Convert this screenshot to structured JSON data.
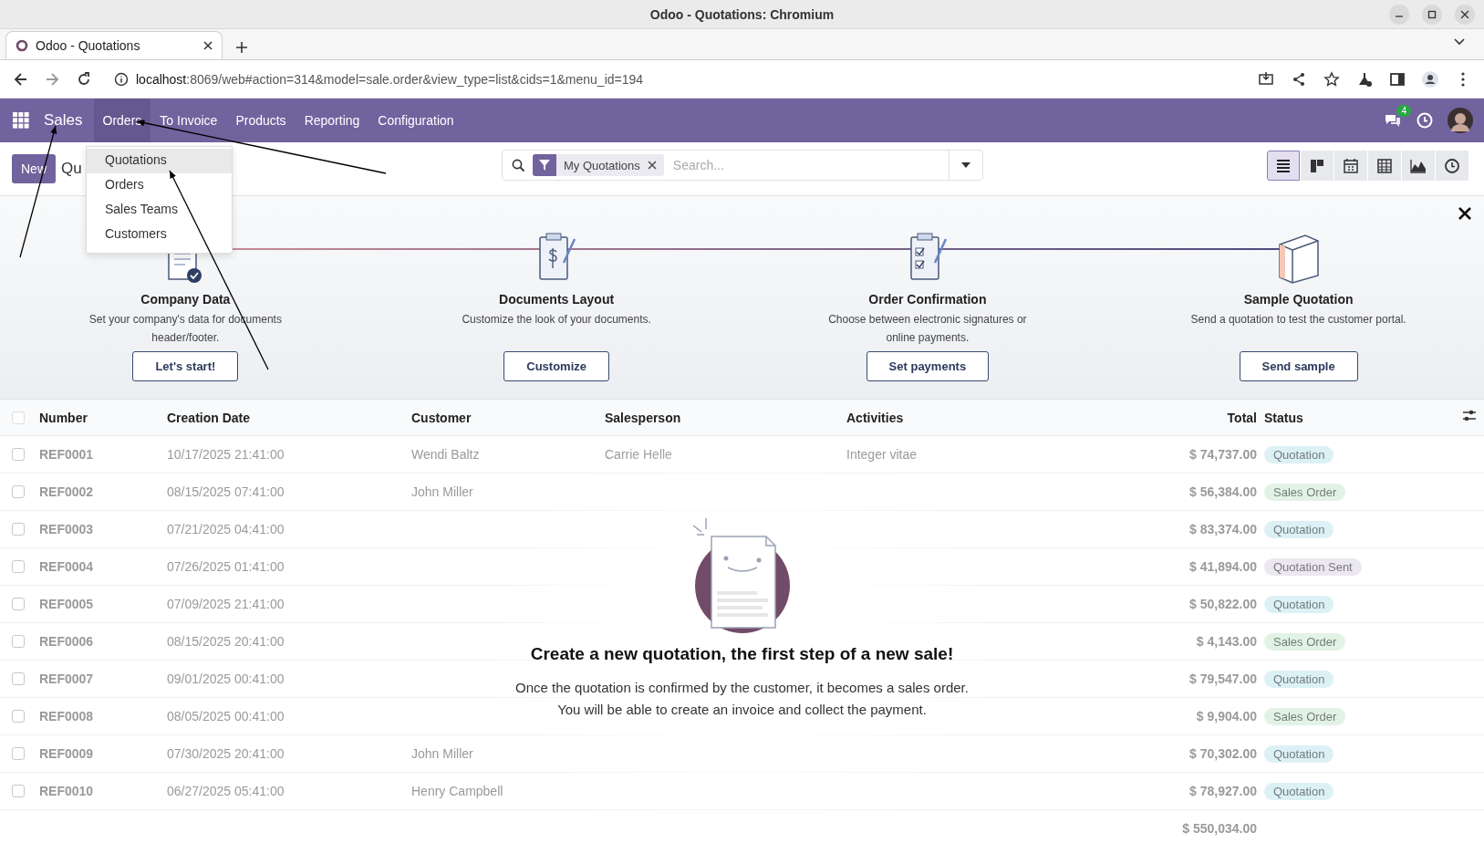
{
  "window": {
    "title": "Odoo - Quotations: Chromium"
  },
  "browser": {
    "tabs": [
      {
        "label": "Odoo - Quotations",
        "selected": true
      }
    ],
    "url_host": "localhost",
    "url_path": ":8069/web#action=314&model=sale.order&view_type=list&cids=1&menu_id=194"
  },
  "navbar": {
    "app": "Sales",
    "menu": [
      {
        "label": "Orders",
        "selected": true
      },
      {
        "label": "To Invoice",
        "selected": false
      },
      {
        "label": "Products",
        "selected": false
      },
      {
        "label": "Reporting",
        "selected": false
      },
      {
        "label": "Configuration",
        "selected": false
      }
    ],
    "messages_badge": "4"
  },
  "dropdown": {
    "items": [
      {
        "label": "Quotations",
        "selected": true
      },
      {
        "label": "Orders",
        "selected": false
      },
      {
        "label": "Sales Teams",
        "selected": false
      },
      {
        "label": "Customers",
        "selected": false
      }
    ]
  },
  "control_panel": {
    "new_button": "New",
    "breadcrumb": "Qu",
    "facet": "My Quotations",
    "search_placeholder": "Search...",
    "views": [
      {
        "kind": "list",
        "selected": true
      },
      {
        "kind": "kanban",
        "selected": false
      },
      {
        "kind": "calendar",
        "selected": false
      },
      {
        "kind": "pivot",
        "selected": false
      },
      {
        "kind": "graph",
        "selected": false
      },
      {
        "kind": "activity",
        "selected": false
      }
    ]
  },
  "onboarding": {
    "steps": [
      {
        "kind": "company",
        "title": "Company Data",
        "description": "Set your company's data for documents header/footer.",
        "button": "Let's start!"
      },
      {
        "kind": "layout",
        "title": "Documents Layout",
        "description": "Customize the look of your documents.",
        "button": "Customize"
      },
      {
        "kind": "confirmation",
        "title": "Order Confirmation",
        "description": "Choose between electronic signatures or online payments.",
        "button": "Set payments"
      },
      {
        "kind": "sample",
        "title": "Sample Quotation",
        "description": "Send a quotation to test the customer portal.",
        "button": "Send sample"
      }
    ]
  },
  "table": {
    "select_all_checked": false,
    "columns": [
      "Number",
      "Creation Date",
      "Customer",
      "Salesperson",
      "Activities",
      "Total",
      "Status"
    ],
    "rows": [
      {
        "checked": false,
        "number": "REF0001",
        "date": "10/17/2025 21:41:00",
        "customer": "Wendi Baltz",
        "salesperson": "Carrie Helle",
        "activity": "Integer vitae",
        "total": "$ 74,737.00",
        "status": "Quotation",
        "color": "#dcf1f5"
      },
      {
        "checked": false,
        "number": "REF0002",
        "date": "08/15/2025 07:41:00",
        "customer": "John Miller",
        "total": "$ 56,384.00",
        "status": "Sales Order",
        "color": "#e2f3e5"
      },
      {
        "checked": false,
        "number": "REF0003",
        "date": "07/21/2025 04:41:00",
        "total": "$ 83,374.00",
        "status": "Quotation",
        "color": "#dcf1f5"
      },
      {
        "checked": false,
        "number": "REF0004",
        "date": "07/26/2025 01:41:00",
        "total": "$ 41,894.00",
        "status": "Quotation Sent",
        "color": "#ebe8f0"
      },
      {
        "checked": false,
        "number": "REF0005",
        "date": "07/09/2025 21:41:00",
        "total": "$ 50,822.00",
        "status": "Quotation",
        "color": "#dcf1f5"
      },
      {
        "checked": false,
        "number": "REF0006",
        "date": "08/15/2025 20:41:00",
        "total": "$ 4,143.00",
        "status": "Sales Order",
        "color": "#e2f3e5"
      },
      {
        "checked": false,
        "number": "REF0007",
        "date": "09/01/2025 00:41:00",
        "total": "$ 79,547.00",
        "status": "Quotation",
        "color": "#dcf1f5"
      },
      {
        "checked": false,
        "number": "REF0008",
        "date": "08/05/2025 00:41:00",
        "total": "$ 9,904.00",
        "status": "Sales Order",
        "color": "#e2f3e5"
      },
      {
        "checked": false,
        "number": "REF0009",
        "date": "07/30/2025 20:41:00",
        "customer": "John Miller",
        "total": "$ 70,302.00",
        "status": "Quotation",
        "color": "#dcf1f5"
      },
      {
        "checked": false,
        "number": "REF0010",
        "date": "06/27/2025 05:41:00",
        "customer": "Henry Campbell",
        "total": "$ 78,927.00",
        "status": "Quotation",
        "color": "#dcf1f5"
      }
    ],
    "sum": "$ 550,034.00"
  },
  "empty_state": {
    "title": "Create a new quotation, the first step of a new sale!",
    "lines": [
      "Once the quotation is confirmed by the customer, it becomes a sales order.",
      "You will be able to create an invoice and collect the payment."
    ]
  }
}
